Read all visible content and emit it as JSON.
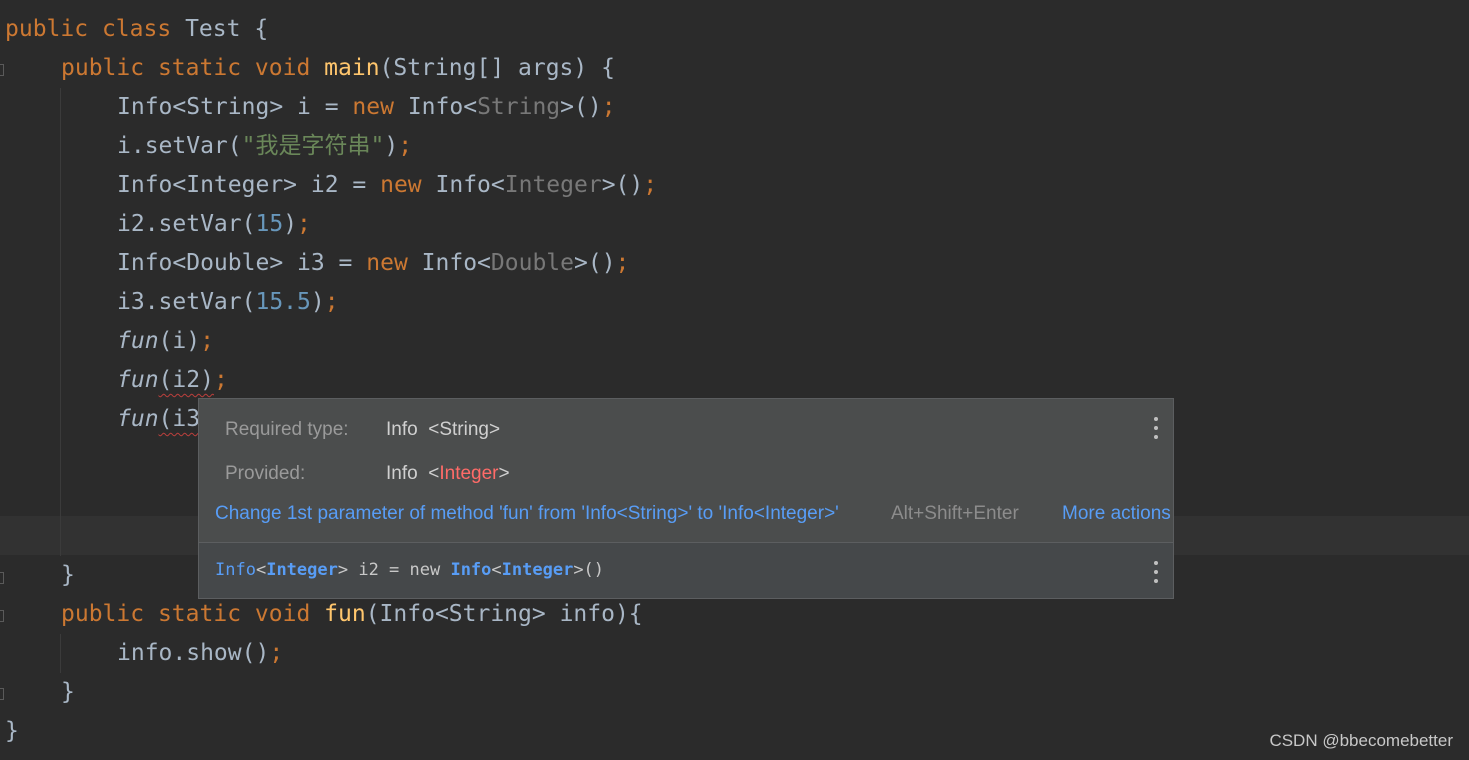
{
  "code": {
    "line1": {
      "kw1": "public",
      "kw2": "class",
      "name": "Test",
      "brace": "{"
    },
    "line2": {
      "kw1": "public",
      "kw2": "static",
      "kw3": "void",
      "fn": "main",
      "rest": "(String[] args) {"
    },
    "line3": {
      "a": "Info<String> i = ",
      "kw": "new",
      "b": "Info<",
      "gray": "String",
      "c": ">()",
      "semi": ";"
    },
    "line4": {
      "a": "i.setVar(",
      "str": "\"我是字符串\"",
      "c": ")",
      "semi": ";"
    },
    "line5": {
      "a": "Info<Integer> i2 = ",
      "kw": "new",
      "b": "Info<",
      "gray": "Integer",
      "c": ">()",
      "semi": ";"
    },
    "line6": {
      "a": "i2.setVar(",
      "num": "15",
      "c": ")",
      "semi": ";"
    },
    "line7": {
      "a": "Info<Double> i3 = ",
      "kw": "new",
      "b": "Info<",
      "gray": "Double",
      "c": ">()",
      "semi": ";"
    },
    "line8": {
      "a": "i3.setVar(",
      "num": "15.5",
      "c": ")",
      "semi": ";"
    },
    "line9": {
      "fn": "fun",
      "args": "(i)",
      "semi": ";"
    },
    "line10": {
      "fn": "fun",
      "args": "(i2)",
      "semi": ";"
    },
    "line11": {
      "fn": "fun",
      "args": "(i3"
    },
    "line12": {
      "brace": "}"
    },
    "line13": {
      "kw1": "public",
      "kw2": "static",
      "kw3": "void",
      "fn": "fun",
      "rest": "(Info<String> info){"
    },
    "line14": {
      "a": "info.show()",
      "semi": ";"
    },
    "line15": {
      "brace": "}"
    },
    "line16": {
      "brace": "}"
    }
  },
  "popup": {
    "required_label": "Required type:",
    "required_value": "Info  <String>",
    "provided_label": "Provided:",
    "provided_prefix": "Info  <",
    "provided_type": "Integer",
    "provided_suffix": ">",
    "quickfix": "Change 1st parameter of method 'fun' from 'Info<String>' to 'Info<Integer>'",
    "shortcut": "Alt+Shift+Enter",
    "more_actions": "More actions",
    "declaration": {
      "t1": "Info",
      "l1": "<",
      "t2": "Integer",
      "g1": "> i2 = new ",
      "t3": "Info",
      "l2": "<",
      "t4": "Integer",
      "g2": ">()"
    }
  },
  "watermark": "CSDN @bbecomebetter",
  "colors": {
    "background": "#2b2b2b",
    "keyword": "#cc7832",
    "function": "#ffc66d",
    "number": "#6897bb",
    "string": "#6a8759",
    "link": "#589df6",
    "error": "#ff6b68"
  }
}
